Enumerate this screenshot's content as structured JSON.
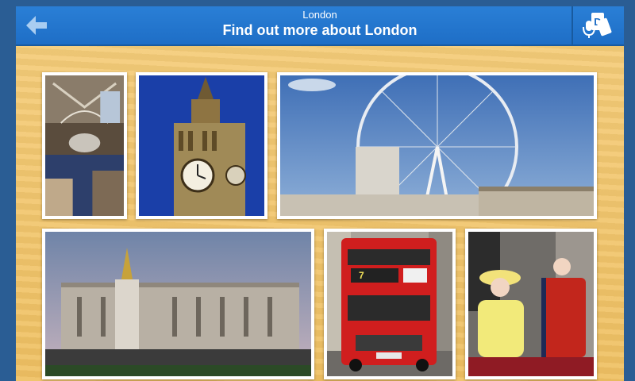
{
  "header": {
    "subtitle": "London",
    "title": "Find out more about London",
    "back_icon": "back-arrow-icon",
    "tool_icon": "dictionary-audio-icon",
    "colors": {
      "bar": "#1e6ec6",
      "board": "#f3c66d"
    }
  },
  "gallery": {
    "photos": [
      {
        "subject": "museum-hall"
      },
      {
        "subject": "big-ben"
      },
      {
        "subject": "london-eye"
      },
      {
        "subject": "buckingham-palace"
      },
      {
        "subject": "red-bus"
      },
      {
        "subject": "royal-balcony"
      }
    ],
    "bus_route_number": "7"
  }
}
